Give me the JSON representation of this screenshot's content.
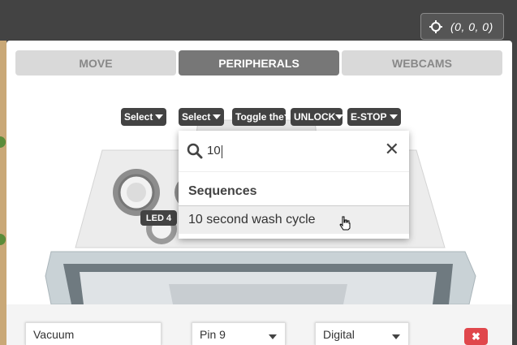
{
  "header": {
    "coords_text": "(0, 0, 0)",
    "coords_icon": "crosshair-icon"
  },
  "tabs": [
    {
      "label": "MOVE",
      "active": false
    },
    {
      "label": "PERIPHERALS",
      "active": true
    },
    {
      "label": "WEBCAMS",
      "active": false
    }
  ],
  "controls": [
    {
      "label": "Select"
    },
    {
      "label": "Select"
    },
    {
      "label": "Toggle the"
    },
    {
      "label": "UNLOCK"
    },
    {
      "label": "E-STOP"
    }
  ],
  "device_label": "LED 4",
  "search": {
    "value": "10",
    "search_icon": "search-icon",
    "clear_icon": "close-icon",
    "clear_glyph": "✕"
  },
  "results": {
    "group_label": "Sequences",
    "items": [
      {
        "label": "10 second wash cycle"
      }
    ]
  },
  "peripheral_row": {
    "name_value": "Vacuum",
    "pin_value": "Pin 9",
    "mode_value": "Digital",
    "delete_glyph": "✖"
  },
  "colors": {
    "dark": "#434343",
    "active_tab": "#777777",
    "danger": "#e0474c"
  }
}
